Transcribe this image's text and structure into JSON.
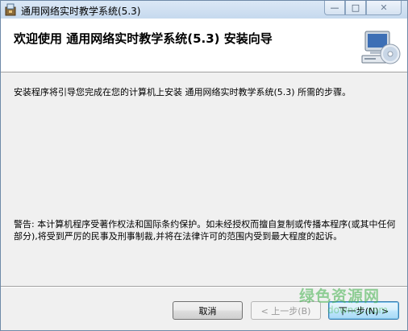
{
  "window": {
    "title": "通用网络实时教学系统(5.3)",
    "controls": {
      "minimize": "—",
      "maximize": "□",
      "close": "✕"
    }
  },
  "header": {
    "title": "欢迎使用 通用网络实时教学系统(5.3) 安装向导",
    "icon": "computer-cd-icon"
  },
  "body": {
    "intro": "安装程序将引导您完成在您的计算机上安装 通用网络实时教学系统(5.3) 所需的步骤。",
    "warning": "警告: 本计算机程序受著作权法和国际条约保护。如未经授权而擅自复制或传播本程序(或其中任何部分),将受到严厉的民事及刑事制裁,并将在法律许可的范围内受到最大程度的起诉。"
  },
  "buttons": {
    "cancel": "取消",
    "back": "< 上一步(B)",
    "next": "下一步(N) >"
  },
  "watermark": {
    "text": "绿色资源网",
    "sub": "downcc.com"
  },
  "colors": {
    "titlebar": "#c6d9ee",
    "header_bg": "#ffffff",
    "dialog_bg": "#f0f0f0",
    "next_border": "#3c7fb1"
  }
}
